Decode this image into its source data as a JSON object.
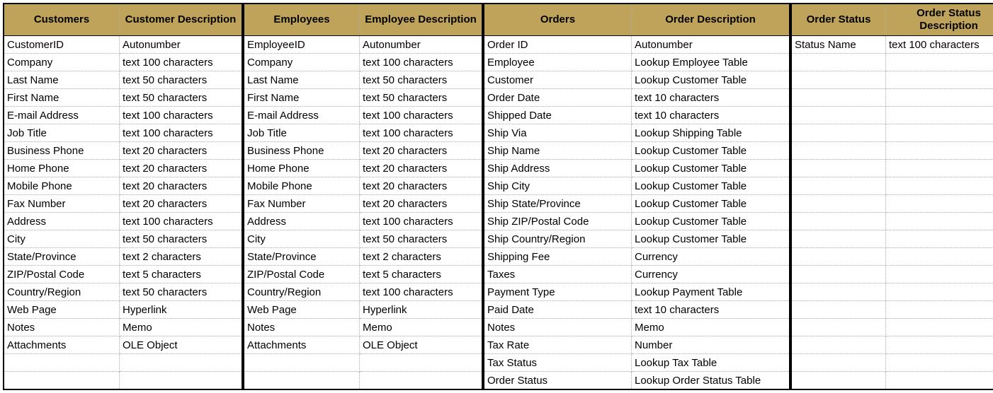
{
  "tables": [
    {
      "headers": [
        "Customers",
        "Customer Description"
      ],
      "rows": [
        [
          "CustomerID",
          "Autonumber"
        ],
        [
          "Company",
          "text 100 characters"
        ],
        [
          "Last Name",
          "text 50 characters"
        ],
        [
          "First Name",
          "text 50 characters"
        ],
        [
          "E-mail Address",
          "text 100 characters"
        ],
        [
          "Job Title",
          "text 100 characters"
        ],
        [
          "Business Phone",
          "text 20 characters"
        ],
        [
          "Home Phone",
          "text 20 characters"
        ],
        [
          "Mobile Phone",
          "text 20 characters"
        ],
        [
          "Fax Number",
          "text 20 characters"
        ],
        [
          "Address",
          "text 100 characters"
        ],
        [
          "City",
          "text 50 characters"
        ],
        [
          "State/Province",
          "text 2 characters"
        ],
        [
          "ZIP/Postal Code",
          "text 5 characters"
        ],
        [
          "Country/Region",
          "text 50 characters"
        ],
        [
          "Web Page",
          "Hyperlink"
        ],
        [
          "Notes",
          "Memo"
        ],
        [
          "Attachments",
          "OLE Object"
        ],
        [
          "",
          ""
        ],
        [
          "",
          ""
        ]
      ]
    },
    {
      "headers": [
        "Employees",
        "Employee Description"
      ],
      "rows": [
        [
          "EmployeeID",
          "Autonumber"
        ],
        [
          "Company",
          "text 100 characters"
        ],
        [
          "Last Name",
          "text 50 characters"
        ],
        [
          "First Name",
          "text 50 characters"
        ],
        [
          "E-mail Address",
          "text 100 characters"
        ],
        [
          "Job Title",
          "text 100 characters"
        ],
        [
          "Business Phone",
          "text 20 characters"
        ],
        [
          "Home Phone",
          "text 20 characters"
        ],
        [
          "Mobile Phone",
          "text 20 characters"
        ],
        [
          "Fax Number",
          "text 20 characters"
        ],
        [
          "Address",
          "text 100 characters"
        ],
        [
          "City",
          "text 50 characters"
        ],
        [
          "State/Province",
          "text 2 characters"
        ],
        [
          "ZIP/Postal Code",
          "text 5 characters"
        ],
        [
          "Country/Region",
          "text 100 characters"
        ],
        [
          "Web Page",
          "Hyperlink"
        ],
        [
          "Notes",
          "Memo"
        ],
        [
          "Attachments",
          "OLE Object"
        ],
        [
          "",
          ""
        ],
        [
          "",
          ""
        ]
      ]
    },
    {
      "headers": [
        "Orders",
        "Order Description"
      ],
      "rows": [
        [
          "Order ID",
          "Autonumber"
        ],
        [
          "Employee",
          "Lookup Employee Table"
        ],
        [
          "Customer",
          "Lookup Customer Table"
        ],
        [
          "Order Date",
          "text 10 characters"
        ],
        [
          "Shipped Date",
          "text 10 characters"
        ],
        [
          "Ship Via",
          "Lookup Shipping Table"
        ],
        [
          "Ship Name",
          "Lookup Customer Table"
        ],
        [
          "Ship Address",
          "Lookup Customer Table"
        ],
        [
          "Ship City",
          "Lookup Customer Table"
        ],
        [
          "Ship State/Province",
          "Lookup Customer Table"
        ],
        [
          "Ship ZIP/Postal Code",
          "Lookup Customer Table"
        ],
        [
          "Ship Country/Region",
          "Lookup Customer Table"
        ],
        [
          "Shipping Fee",
          "Currency"
        ],
        [
          "Taxes",
          "Currency"
        ],
        [
          "Payment Type",
          "Lookup Payment Table"
        ],
        [
          "Paid Date",
          "text 10 characters"
        ],
        [
          "Notes",
          "Memo"
        ],
        [
          "Tax Rate",
          "Number"
        ],
        [
          "Tax Status",
          "Lookup Tax Table"
        ],
        [
          "Order Status",
          "Lookup Order Status Table"
        ]
      ]
    },
    {
      "headers": [
        "Order Status",
        "Order Status Description"
      ],
      "rows": [
        [
          "Status Name",
          "text 100 characters"
        ],
        [
          "",
          ""
        ],
        [
          "",
          ""
        ],
        [
          "",
          ""
        ],
        [
          "",
          ""
        ],
        [
          "",
          ""
        ],
        [
          "",
          ""
        ],
        [
          "",
          ""
        ],
        [
          "",
          ""
        ],
        [
          "",
          ""
        ],
        [
          "",
          ""
        ],
        [
          "",
          ""
        ],
        [
          "",
          ""
        ],
        [
          "",
          ""
        ],
        [
          "",
          ""
        ],
        [
          "",
          ""
        ],
        [
          "",
          ""
        ],
        [
          "",
          ""
        ],
        [
          "",
          ""
        ],
        [
          "",
          ""
        ]
      ]
    }
  ]
}
